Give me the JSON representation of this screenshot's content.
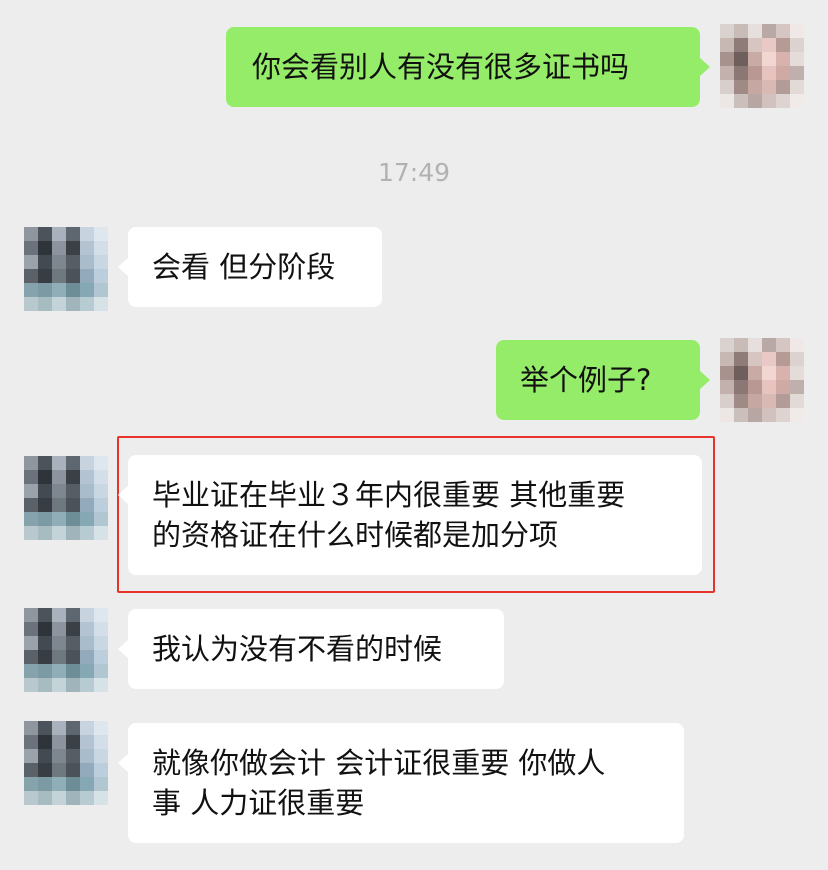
{
  "chat": {
    "timestamp": "17:49",
    "messages": [
      {
        "side": "sent",
        "text": "你会看别人有没有很多证书吗"
      },
      {
        "side": "recv",
        "text": "会看 但分阶段"
      },
      {
        "side": "sent",
        "text": "举个例子?"
      },
      {
        "side": "recv",
        "text": "毕业证在毕业３年内很重要 其他重要\n的资格证在什么时候都是加分项",
        "highlighted": true
      },
      {
        "side": "recv",
        "text": "我认为没有不看的时候"
      },
      {
        "side": "recv",
        "text": "就像你做会计 会计证很重要 你做人\n事 人力证很重要"
      }
    ]
  },
  "colors": {
    "background": "#ededed",
    "sent_bubble": "#95ec69",
    "recv_bubble": "#ffffff",
    "highlight_border": "#e8332a",
    "timestamp_text": "#b2b2b2"
  },
  "avatars": {
    "self": "pixelated-self-avatar",
    "contact": "pixelated-contact-avatar"
  }
}
